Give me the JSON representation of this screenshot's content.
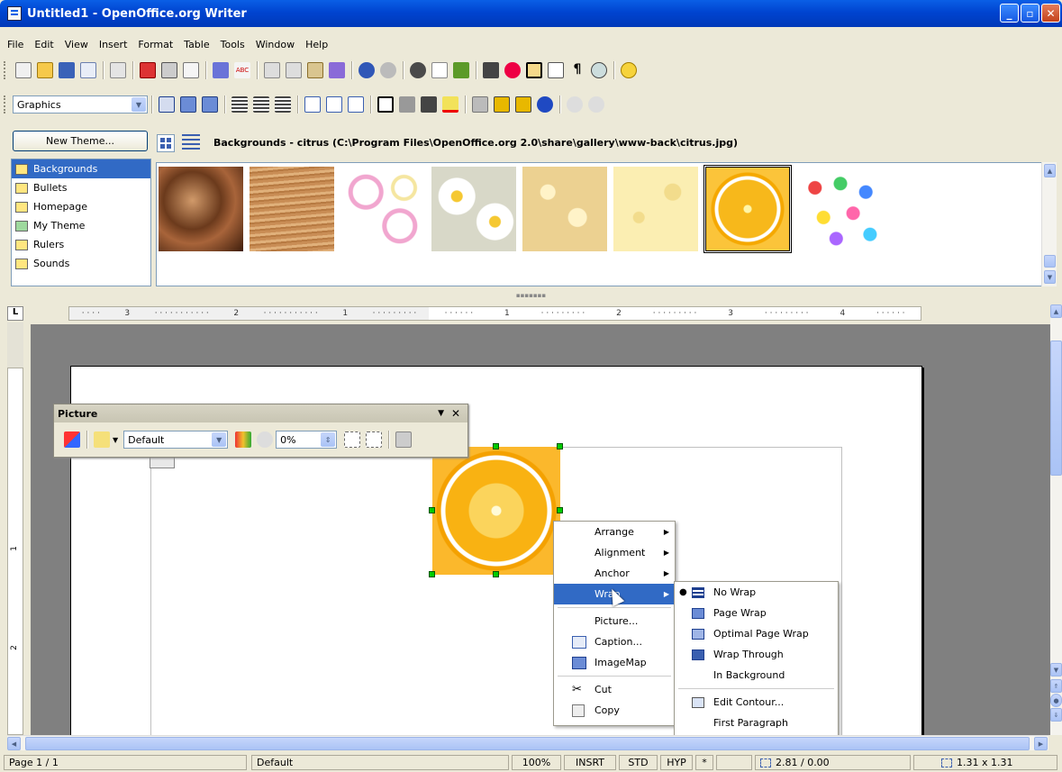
{
  "window": {
    "title": "Untitled1 - OpenOffice.org Writer"
  },
  "menubar": [
    "File",
    "Edit",
    "View",
    "Insert",
    "Format",
    "Table",
    "Tools",
    "Window",
    "Help"
  ],
  "formatbar": {
    "style_value": "Graphics"
  },
  "gallery": {
    "new_theme_label": "New Theme...",
    "path_text": "Backgrounds - citrus (C:\\Program Files\\OpenOffice.org 2.0\\share\\gallery\\www-back\\citrus.jpg)",
    "themes": [
      "Backgrounds",
      "Bullets",
      "Homepage",
      "My Theme",
      "Rulers",
      "Sounds"
    ],
    "selected_theme": "Backgrounds",
    "thumbnails": [
      "chocolate",
      "wood",
      "rings",
      "daisies",
      "popcorn",
      "cheese",
      "citrus",
      "confetti"
    ],
    "selected_thumbnail": "citrus"
  },
  "ruler": {
    "left_labels": [
      "3",
      "2",
      "1"
    ],
    "right_labels": [
      "1",
      "2",
      "3",
      "4"
    ],
    "vertical_labels": [
      "1",
      "2"
    ]
  },
  "picture_toolbar": {
    "title": "Picture",
    "filter_mode": "Default",
    "transparency": "0%"
  },
  "context_menu": {
    "items": [
      {
        "label": "Arrange",
        "submenu": true
      },
      {
        "label": "Alignment",
        "submenu": true
      },
      {
        "label": "Anchor",
        "submenu": true
      },
      {
        "label": "Wrap",
        "submenu": true,
        "highlighted": true
      },
      {
        "label": "Picture...",
        "submenu": false
      },
      {
        "label": "Caption...",
        "submenu": false
      },
      {
        "label": "ImageMap",
        "submenu": false
      },
      {
        "label": "Cut",
        "submenu": false
      },
      {
        "label": "Copy",
        "submenu": false
      }
    ]
  },
  "wrap_submenu": {
    "items": [
      {
        "label": "No Wrap",
        "checked": true
      },
      {
        "label": "Page Wrap"
      },
      {
        "label": "Optimal Page Wrap"
      },
      {
        "label": "Wrap Through"
      },
      {
        "label": "In Background"
      },
      {
        "label": "Edit Contour..."
      },
      {
        "label": "First Paragraph"
      }
    ]
  },
  "statusbar": {
    "page": "Page 1 / 1",
    "page_style": "Default",
    "zoom": "100%",
    "insert_mode": "INSRT",
    "selection_mode": "STD",
    "hyperlink_mode": "HYP",
    "modified": "*",
    "position": "2.81 / 0.00",
    "size": "1.31 x 1.31"
  },
  "colors": {
    "titlebar": "#0a5fe6",
    "highlight": "#316ac5",
    "handle": "#00cc00"
  }
}
